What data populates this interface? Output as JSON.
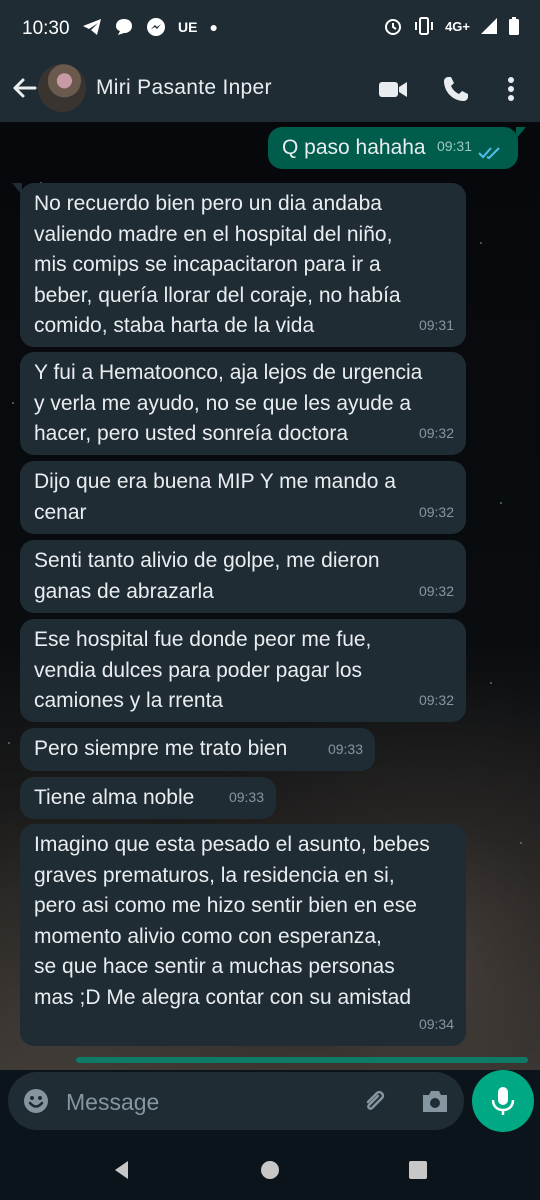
{
  "status_bar": {
    "time": "10:30",
    "carrier": "UE",
    "network": "4G+",
    "notification_icons": [
      "telegram-icon",
      "chat-bubble-icon",
      "messenger-icon"
    ],
    "right_icons": [
      "alarm-icon",
      "vibrate-icon",
      "signal-icon",
      "battery-icon"
    ]
  },
  "header": {
    "contact_name": "Miri Pasante Inper",
    "actions": [
      "video-call-icon",
      "voice-call-icon",
      "more-options-icon"
    ]
  },
  "messages": [
    {
      "direction": "outgoing",
      "text": "Q paso hahaha",
      "time": "09:31",
      "status": "read"
    },
    {
      "direction": "incoming",
      "text": "No recuerdo bien pero un dia andaba\nvaliendo madre en el hospital del niño,\nmis comips se incapacitaron para ir a\nbeber, quería llorar del coraje, no había\ncomido, staba harta de la vida",
      "time": "09:31"
    },
    {
      "direction": "incoming",
      "text": "Y fui a Hematoonco, aja lejos de urgencia\ny verla me ayudo, no se que les ayude a\nhacer, pero usted sonreía doctora",
      "time": "09:32"
    },
    {
      "direction": "incoming",
      "text": "Dijo que era buena MIP Y me mando a\ncenar",
      "time": "09:32"
    },
    {
      "direction": "incoming",
      "text": "Senti tanto alivio de golpe, me dieron\nganas de abrazarla",
      "time": "09:32"
    },
    {
      "direction": "incoming",
      "text": "Ese hospital fue donde peor me fue,\nvendia dulces para poder pagar los\ncamiones y la rrenta",
      "time": "09:32"
    },
    {
      "direction": "incoming",
      "text": "Pero siempre me trato bien",
      "time": "09:33"
    },
    {
      "direction": "incoming",
      "text": "Tiene alma noble",
      "time": "09:33"
    },
    {
      "direction": "incoming",
      "text": "Imagino que esta pesado el asunto, bebes\ngraves prematuros, la residencia en si,\npero asi como me hizo sentir bien en ese\nmomento alivio como con esperanza,\nse que hace sentir a muchas personas\nmas ;D Me alegra contar con su amistad",
      "time": "09:34"
    }
  ],
  "composer": {
    "placeholder": "Message",
    "icons": [
      "emoji-icon",
      "attach-icon",
      "camera-icon",
      "microphone-icon"
    ]
  },
  "colors": {
    "bar_bg": "#1f2c34",
    "incoming_bubble": "#1f2c34",
    "outgoing_bubble": "#005c4b",
    "accent": "#00a884",
    "read_ticks": "#53bdeb"
  },
  "nav_buttons": [
    "back-triangle-icon",
    "home-circle-icon",
    "recents-square-icon"
  ]
}
